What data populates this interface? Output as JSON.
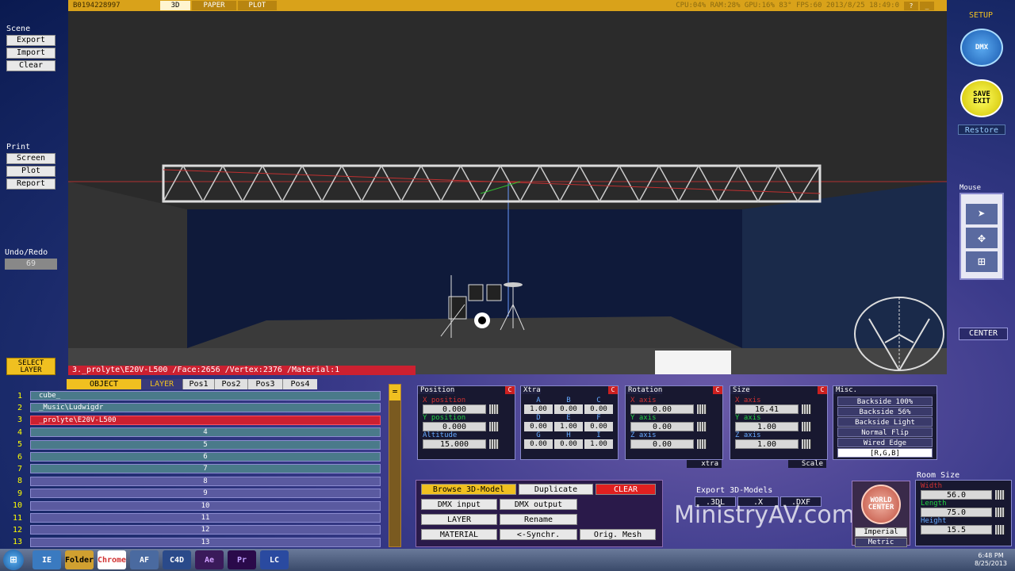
{
  "topbar": {
    "serial": "B0194228997",
    "tabs": [
      "3D",
      "PAPER",
      "PLOT"
    ],
    "stats": "CPU:04% RAM:28% GPU:16% 83° FPS:60  2013/8/25 18:49:0",
    "help": "?",
    "min": "_"
  },
  "left": {
    "scene_label": "Scene",
    "scene_buttons": [
      "Export",
      "Import",
      "Clear"
    ],
    "print_label": "Print",
    "print_buttons": [
      "Screen",
      "Plot",
      "Report"
    ],
    "undo_label": "Undo/Redo",
    "undo_value": "69",
    "select_layer": "SELECT LAYER"
  },
  "right": {
    "setup": "SETUP",
    "dmx": "DMX",
    "save_exit": "SAVE EXIT",
    "restore": "Restore",
    "mouse_label": "Mouse",
    "center": "CENTER"
  },
  "status_line": "3._prolyte\\E20V-L500 /Face:2656 /Vertex:2376 /Material:1",
  "layers": {
    "tabs": [
      "OBJECT",
      "LAYER",
      "Pos1",
      "Pos2",
      "Pos3",
      "Pos4"
    ],
    "rows": [
      {
        "num": "1",
        "label": "cube_",
        "selected": false,
        "alt": true
      },
      {
        "num": "2",
        "label": "_Music\\Ludwigdr",
        "selected": false,
        "alt": true
      },
      {
        "num": "3",
        "label": "_prolyte\\E20V-L500",
        "selected": true,
        "alt": false
      },
      {
        "num": "4",
        "label": "4",
        "selected": false,
        "alt": true
      },
      {
        "num": "5",
        "label": "5",
        "selected": false,
        "alt": true
      },
      {
        "num": "6",
        "label": "6",
        "selected": false,
        "alt": true
      },
      {
        "num": "7",
        "label": "7",
        "selected": false,
        "alt": true
      },
      {
        "num": "8",
        "label": "8",
        "selected": false,
        "alt": false
      },
      {
        "num": "9",
        "label": "9",
        "selected": false,
        "alt": false
      },
      {
        "num": "10",
        "label": "10",
        "selected": false,
        "alt": false
      },
      {
        "num": "11",
        "label": "11",
        "selected": false,
        "alt": false
      },
      {
        "num": "12",
        "label": "12",
        "selected": false,
        "alt": false
      },
      {
        "num": "13",
        "label": "13",
        "selected": false,
        "alt": false
      }
    ],
    "eq_button": "="
  },
  "position": {
    "title": "Position",
    "badge": "C",
    "x_label": "X position",
    "x": "0.000",
    "y_label": "Y position",
    "y": "0.000",
    "alt_label": "Altitude",
    "alt": "15.000"
  },
  "xtra": {
    "title": "Xtra",
    "badge": "C",
    "headers1": [
      "A",
      "B",
      "C"
    ],
    "row1": [
      "1.00",
      "0.00",
      "0.00"
    ],
    "headers2": [
      "D",
      "E",
      "F"
    ],
    "row2": [
      "0.00",
      "1.00",
      "0.00"
    ],
    "headers3": [
      "G",
      "H",
      "I"
    ],
    "row3": [
      "0.00",
      "0.00",
      "1.00"
    ]
  },
  "rotation": {
    "title": "Rotation",
    "badge": "C",
    "x_label": "X axis",
    "x": "0.00",
    "y_label": "Y axis",
    "y": "0.00",
    "z_label": "Z axis",
    "z": "0.00",
    "footer": "xtra"
  },
  "size": {
    "title": "Size",
    "badge": "C",
    "x_label": "X axis",
    "x": "16.41",
    "y_label": "Y axis",
    "y": "1.00",
    "z_label": "Z axis",
    "z": "1.00",
    "footer": "Scale"
  },
  "misc": {
    "title": "Misc.",
    "buttons": [
      "Backside 100%",
      "Backside 56%",
      "Backside Light",
      "Normal Flip",
      "Wired Edge",
      "[R,G,B]"
    ]
  },
  "actions": {
    "browse": "Browse 3D-Model",
    "duplicate": "Duplicate",
    "clear": "CLEAR",
    "dmx_in": "DMX input",
    "dmx_out": "DMX output",
    "layer": "LAYER",
    "rename": "Rename",
    "material": "MATERIAL",
    "synchr": "<-Synchr.",
    "orig_mesh": "Orig. Mesh"
  },
  "export": {
    "title": "Export 3D-Models",
    "buttons": [
      ".3DL",
      ".X",
      ".DXF"
    ]
  },
  "world": {
    "label": "WORLD CENTER",
    "imperial": "Imperial",
    "metric": "Metric"
  },
  "room": {
    "title": "Room Size",
    "width_label": "Width",
    "width": "56.0",
    "length_label": "Length",
    "length": "75.0",
    "height_label": "Height",
    "height": "15.5"
  },
  "watermark": "MinistryAV.com",
  "taskbar": {
    "time": "6:48 PM",
    "date": "8/25/2013",
    "apps": [
      "IE",
      "Folder",
      "Chrome",
      "AF",
      "C4D",
      "Ae",
      "Pr",
      "LC"
    ]
  }
}
